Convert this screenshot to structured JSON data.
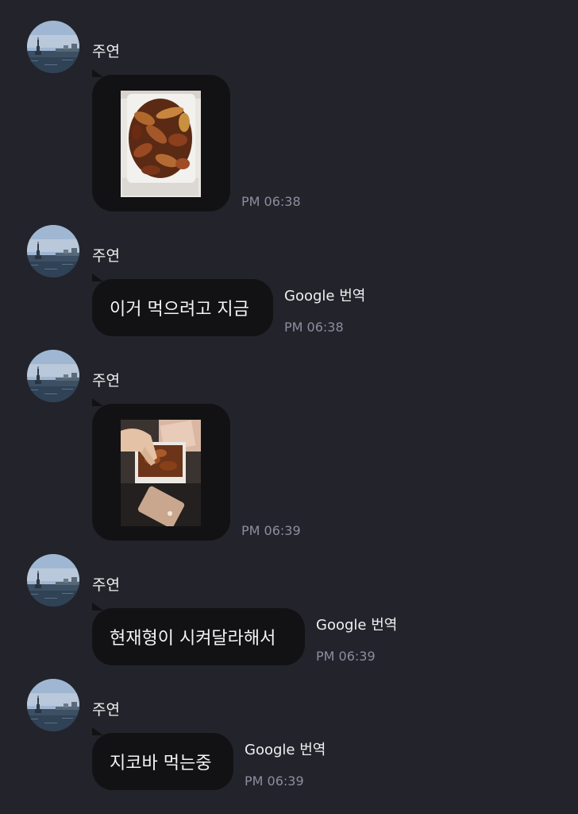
{
  "messages": [
    {
      "sender": "주연",
      "type": "photo",
      "photo_desc": "fried chicken in takeout box",
      "time": "PM 06:38"
    },
    {
      "sender": "주연",
      "type": "text",
      "text": "이거 먹으려고 지금",
      "translate": "Google 번역",
      "time": "PM 06:38"
    },
    {
      "sender": "주연",
      "type": "photo",
      "photo_desc": "hand reaching into chicken box",
      "time": "PM 06:39"
    },
    {
      "sender": "주연",
      "type": "text",
      "text": "현재형이 시켜달라해서",
      "translate": "Google 번역",
      "time": "PM 06:39"
    },
    {
      "sender": "주연",
      "type": "text",
      "text": "지코바 먹는중",
      "translate": "Google 번역",
      "time": "PM 06:39"
    }
  ],
  "colors": {
    "background": "#23232b",
    "bubble": "#121214",
    "timestamp": "#8d8da0"
  },
  "icons": {
    "avatar": "statue-of-liberty-harbor-avatar"
  }
}
